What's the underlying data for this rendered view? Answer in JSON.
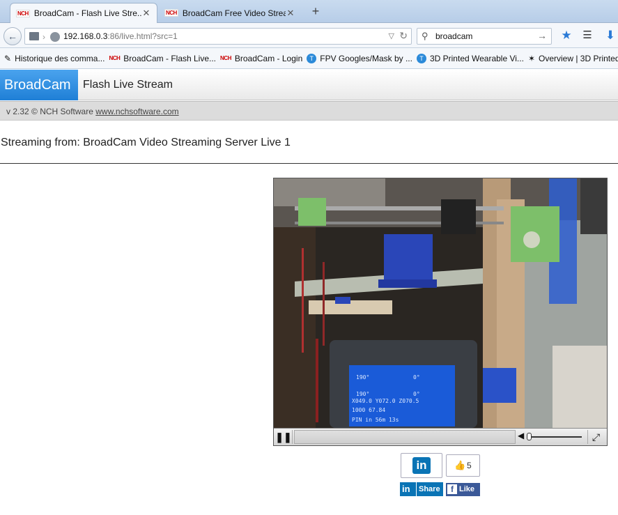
{
  "browser": {
    "tabs": [
      {
        "title": "BroadCam - Flash Live Stre...",
        "favicon": "NCH",
        "active": true
      },
      {
        "title": "BroadCam Free Video Strea...",
        "favicon": "NCH",
        "active": false
      }
    ],
    "url_host": "192.168.0.3",
    "url_path": ":86/live.html?src=1",
    "search_query": "broadcam"
  },
  "bookmarks": [
    {
      "label": "Historique des comma...",
      "icon": "wrench-icon"
    },
    {
      "label": "BroadCam - Flash Live...",
      "icon": "NCH"
    },
    {
      "label": "BroadCam - Login",
      "icon": "NCH"
    },
    {
      "label": "FPV Googles/Mask by ...",
      "icon": "T"
    },
    {
      "label": "3D Printed Wearable Vi...",
      "icon": "T"
    },
    {
      "label": "Overview | 3D Printed",
      "icon": "star-icon"
    }
  ],
  "page": {
    "brand": "BroadCam",
    "subtitle": "Flash Live Stream",
    "version": "v 2.32 © NCH Software",
    "website": "www.nchsoftware.com",
    "streaming_label": "Streaming from: BroadCam Video Streaming Server Live 1"
  },
  "player": {
    "lcd_lines": [
      "190°",
      "0°",
      "190°",
      "0°",
      "X049.0 Y072.0 Z070.5",
      "1000 67.84",
      "PIN in 56m 13s"
    ]
  },
  "social": {
    "linkedin_label": "Share",
    "facebook_label": "Like",
    "facebook_count": "5"
  },
  "colors": {
    "brand_blue": "#1f7fd6",
    "linkedin": "#0a74b5",
    "facebook": "#3b5998"
  }
}
